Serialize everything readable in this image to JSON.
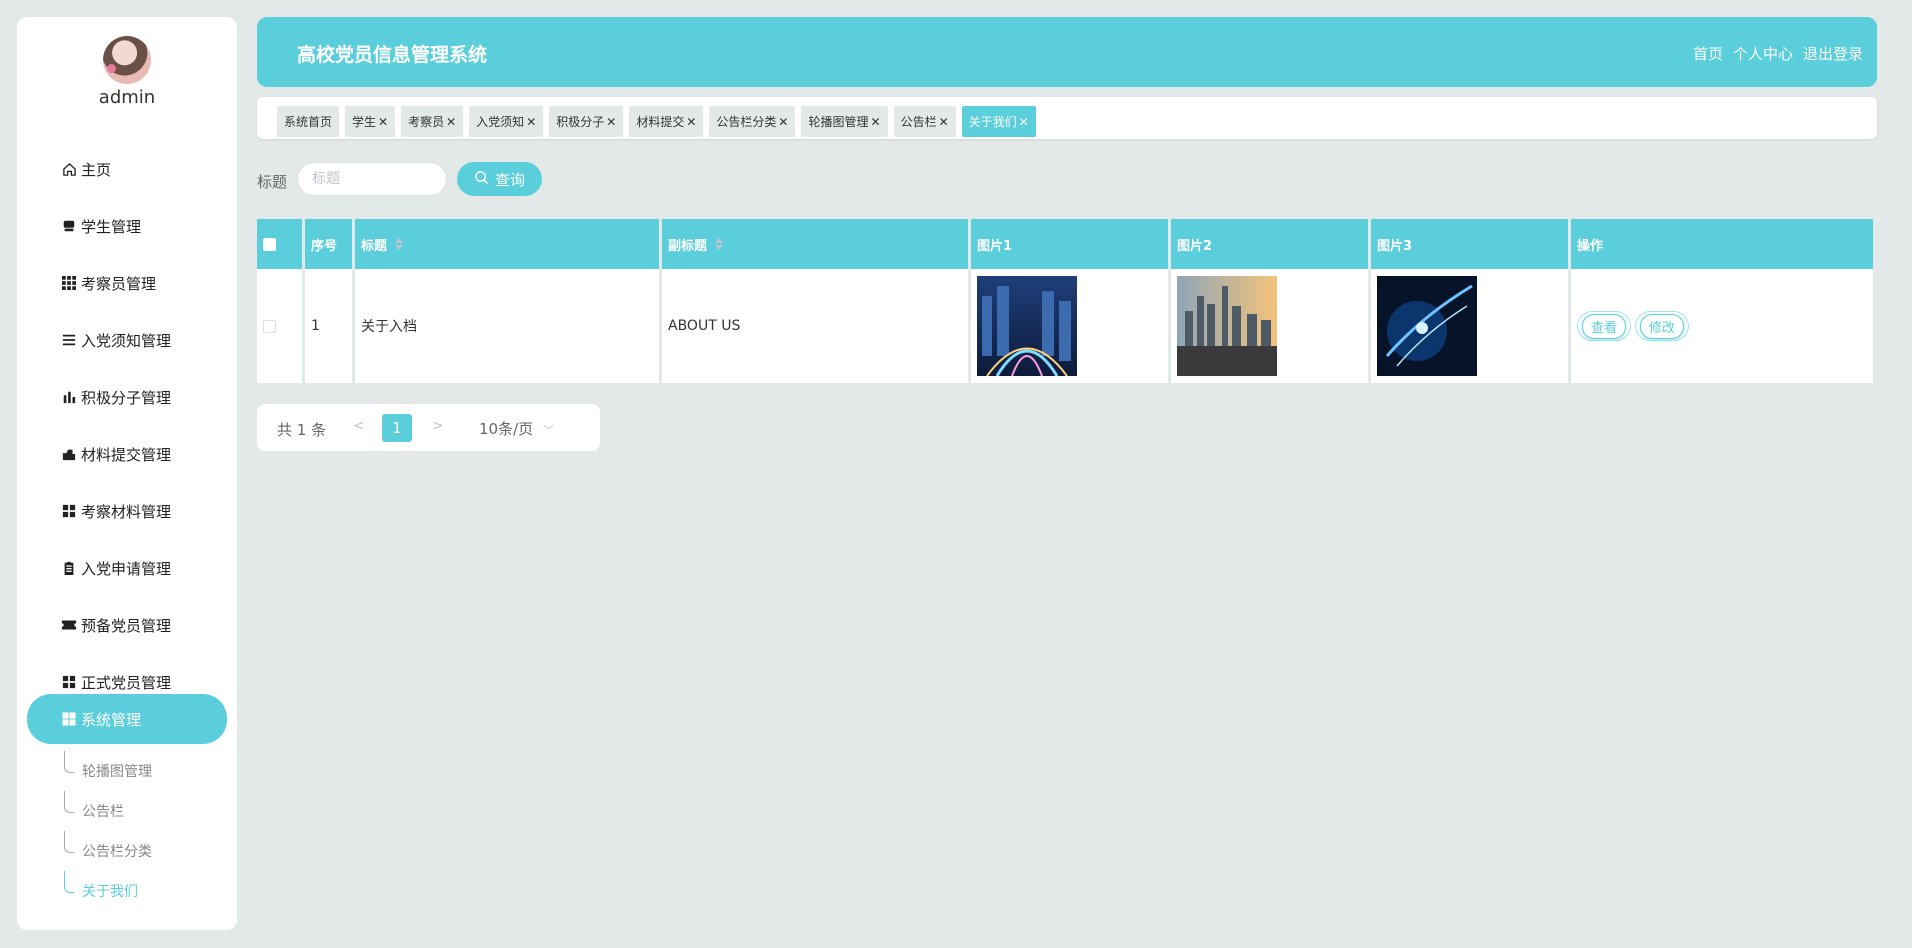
{
  "user": {
    "name": "admin"
  },
  "sidebar": {
    "items": [
      {
        "label": "主页",
        "icon": "home-icon"
      },
      {
        "label": "学生管理",
        "icon": "student-icon"
      },
      {
        "label": "考察员管理",
        "icon": "grid-icon"
      },
      {
        "label": "入党须知管理",
        "icon": "list-icon"
      },
      {
        "label": "积极分子管理",
        "icon": "bar-chart-icon"
      },
      {
        "label": "材料提交管理",
        "icon": "submit-icon"
      },
      {
        "label": "考察材料管理",
        "icon": "apps-icon"
      },
      {
        "label": "入党申请管理",
        "icon": "clipboard-icon"
      },
      {
        "label": "预备党员管理",
        "icon": "ticket-icon"
      },
      {
        "label": "正式党员管理",
        "icon": "apps-icon"
      },
      {
        "label": "系统管理",
        "icon": "apps-icon"
      }
    ],
    "sub_items": [
      {
        "label": "轮播图管理"
      },
      {
        "label": "公告栏"
      },
      {
        "label": "公告栏分类"
      },
      {
        "label": "关于我们"
      }
    ]
  },
  "header": {
    "title": "高校党员信息管理系统",
    "links": [
      "首页",
      "个人中心",
      "退出登录"
    ]
  },
  "tabs": [
    {
      "label": "系统首页",
      "closable": false
    },
    {
      "label": "学生",
      "closable": true
    },
    {
      "label": "考察员",
      "closable": true
    },
    {
      "label": "入党须知",
      "closable": true
    },
    {
      "label": "积极分子",
      "closable": true
    },
    {
      "label": "材料提交",
      "closable": true
    },
    {
      "label": "公告栏分类",
      "closable": true
    },
    {
      "label": "轮播图管理",
      "closable": true
    },
    {
      "label": "公告栏",
      "closable": true
    },
    {
      "label": "关于我们",
      "closable": true
    }
  ],
  "search": {
    "label": "标题",
    "placeholder": "标题",
    "button": "查询"
  },
  "table": {
    "headers": [
      "序号",
      "标题",
      "副标题",
      "图片1",
      "图片2",
      "图片3",
      "操作"
    ],
    "rows": [
      {
        "index": "1",
        "title": "关于入档",
        "subtitle": "ABOUT US",
        "actions": [
          "查看",
          "修改"
        ]
      }
    ]
  },
  "pagination": {
    "total": "共 1 条",
    "prev": "<",
    "page": "1",
    "next": ">",
    "size": "10条/页"
  },
  "colors": {
    "accent": "#5bcedb",
    "background": "#e3e8e8"
  }
}
